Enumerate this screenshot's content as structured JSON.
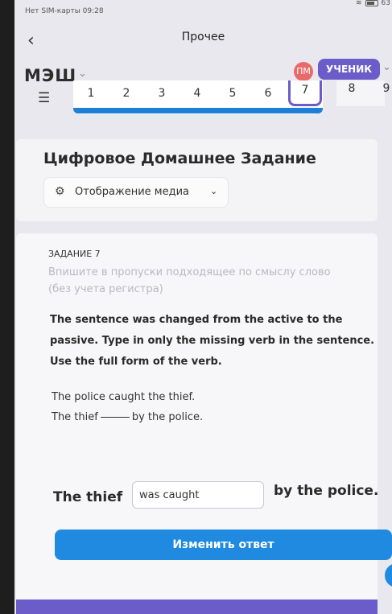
{
  "status_bar": {
    "carrier_time": "Нет SIM-карты 09:28",
    "battery": "63"
  },
  "topbar": {
    "back_icon": "chevron-left-icon",
    "title": "Прочее"
  },
  "app_header": {
    "brand": "МЭШ",
    "avatar_initials": "ПМ",
    "role": "УЧЕНИК"
  },
  "pager": {
    "pages": [
      "1",
      "2",
      "3",
      "4",
      "5",
      "6"
    ],
    "current": "7",
    "next": "8",
    "next2": "9"
  },
  "main": {
    "title": "Цифровое Домашнее Задание",
    "media_button": "Отображение медиа"
  },
  "task": {
    "label": "ЗАДАНИЕ 7",
    "instruction_line1": "Впишите в пропуски подходящее по смыслу слово",
    "instruction_line2": "(без учета регистра)",
    "question": "The sentence was changed from the active to the passive. Type in only the missing verb in the sentence. Use the full form of the verb.",
    "sentence_active": "The police caught the thief.",
    "sentence_passive_start": "The thief",
    "sentence_passive_end": "by the police.",
    "answer_prefix": "The thief",
    "answer_value": "was caught",
    "answer_suffix": "by the police.",
    "change_button": "Изменить ответ"
  },
  "colors": {
    "accent": "#1f8ae0",
    "badge": "#6b5cc9",
    "avatar": "#e86a6a"
  }
}
